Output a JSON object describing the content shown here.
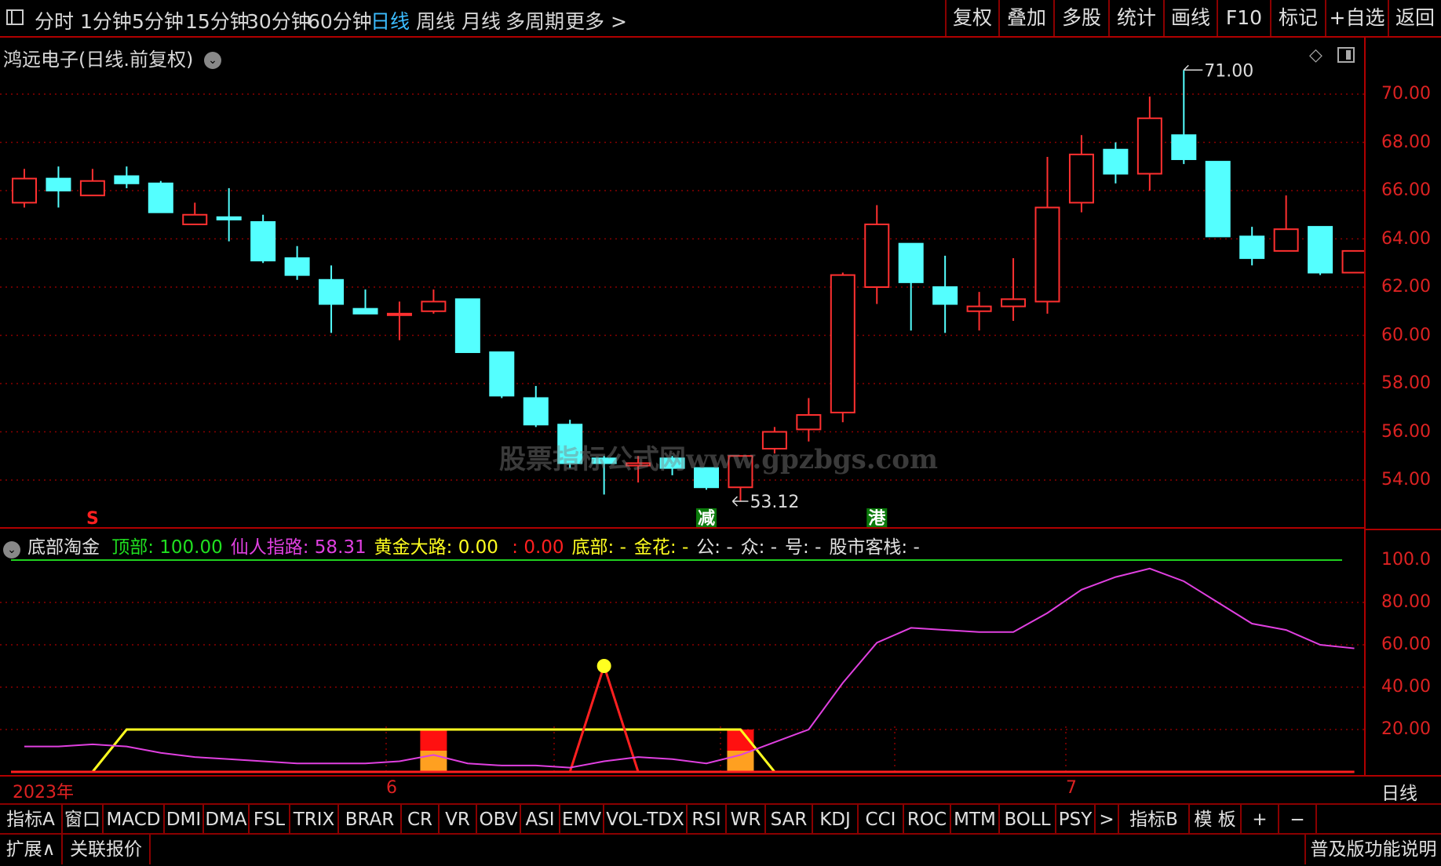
{
  "toolbar": {
    "left_items": [
      "分时",
      "1分钟",
      "5分钟",
      "15分钟",
      "30分钟",
      "60分钟",
      "日线",
      "周线",
      "月线",
      "多周期",
      "更多 >"
    ],
    "active": "日线",
    "right_items": [
      "复权",
      "叠加",
      "多股",
      "统计",
      "画线",
      "F10",
      "标记",
      "+自选",
      "返回"
    ]
  },
  "main": {
    "title": "鸿远电子(日线.前复权)",
    "high_label": "71.00",
    "low_label": "53.12",
    "signals": [
      {
        "text": "S",
        "color": "#ff2020"
      },
      {
        "text": "减",
        "color": "#30d030"
      },
      {
        "text": "港",
        "color": "#30d030"
      }
    ],
    "watermark": "股票指标公式网www.gpzbgs.com",
    "y_labels": [
      "70.00",
      "68.00",
      "66.00",
      "64.00",
      "62.00",
      "60.00",
      "58.00",
      "56.00",
      "54.00"
    ],
    "y_values": [
      70,
      68,
      66,
      64,
      62,
      60,
      58,
      56,
      54
    ]
  },
  "indicator": {
    "name": "底部淘金",
    "fields": [
      {
        "label": "顶部: ",
        "value": "100.00",
        "color": "#20e020"
      },
      {
        "label": "仙人指路: ",
        "value": "58.31",
        "color": "#e040e0"
      },
      {
        "label": "黄金大路: ",
        "value": "0.00",
        "color": "#ffff20"
      },
      {
        "label": " : ",
        "value": "0.00",
        "color": "#ff2020"
      },
      {
        "label": "底部: ",
        "value": "-",
        "color": "#ffff20"
      },
      {
        "label": "金花: ",
        "value": "-",
        "color": "#ffff20"
      },
      {
        "label": "公: ",
        "value": "-",
        "color": "#e0e0e0"
      },
      {
        "label": "众: ",
        "value": "-",
        "color": "#e0e0e0"
      },
      {
        "label": "号: ",
        "value": "-",
        "color": "#e0e0e0"
      },
      {
        "label": "股市客栈: ",
        "value": "-",
        "color": "#e0e0e0"
      }
    ],
    "y_labels": [
      "100.0",
      "80.00",
      "60.00",
      "40.00",
      "20.00"
    ],
    "y_values": [
      100,
      80,
      60,
      40,
      20
    ]
  },
  "date_axis": {
    "labels": [
      "2023年",
      "6",
      "7"
    ],
    "period": "日线"
  },
  "bottom_tabs": [
    "指标A",
    "窗口",
    "MACD",
    "DMI",
    "DMA",
    "FSL",
    "TRIX",
    "BRAR",
    "CR",
    "VR",
    "OBV",
    "ASI",
    "EMV",
    "VOL-TDX",
    "RSI",
    "WR",
    "SAR",
    "KDJ",
    "CCI",
    "ROC",
    "MTM",
    "BOLL",
    "PSY",
    ">",
    "指标B",
    "模 板",
    "+",
    "−"
  ],
  "status_bar": {
    "left": [
      "扩展∧",
      "关联报价"
    ],
    "right": "普及版功能说明"
  },
  "chart_data": {
    "type": "candlestick",
    "title": "鸿远电子(日线.前复权)",
    "candles": [
      {
        "o": 65.5,
        "h": 66.9,
        "l": 65.3,
        "c": 66.5
      },
      {
        "o": 66.5,
        "h": 67.0,
        "l": 65.3,
        "c": 66.0
      },
      {
        "o": 65.8,
        "h": 66.9,
        "l": 65.8,
        "c": 66.4
      },
      {
        "o": 66.6,
        "h": 67.0,
        "l": 66.1,
        "c": 66.3
      },
      {
        "o": 66.3,
        "h": 66.4,
        "l": 65.1,
        "c": 65.1
      },
      {
        "o": 64.6,
        "h": 65.5,
        "l": 64.6,
        "c": 65.0
      },
      {
        "o": 64.9,
        "h": 66.1,
        "l": 63.9,
        "c": 64.8
      },
      {
        "o": 64.7,
        "h": 65.0,
        "l": 63.0,
        "c": 63.1
      },
      {
        "o": 63.2,
        "h": 63.7,
        "l": 62.3,
        "c": 62.5
      },
      {
        "o": 62.3,
        "h": 62.9,
        "l": 60.1,
        "c": 61.3
      },
      {
        "o": 61.1,
        "h": 61.9,
        "l": 60.9,
        "c": 60.9
      },
      {
        "o": 60.9,
        "h": 61.4,
        "l": 59.8,
        "c": 60.9
      },
      {
        "o": 61.0,
        "h": 61.9,
        "l": 60.9,
        "c": 61.4
      },
      {
        "o": 61.5,
        "h": 61.5,
        "l": 59.3,
        "c": 59.3
      },
      {
        "o": 59.3,
        "h": 59.3,
        "l": 57.4,
        "c": 57.5
      },
      {
        "o": 57.4,
        "h": 57.9,
        "l": 56.2,
        "c": 56.3
      },
      {
        "o": 56.3,
        "h": 56.5,
        "l": 54.5,
        "c": 54.7
      },
      {
        "o": 54.9,
        "h": 55.0,
        "l": 53.4,
        "c": 54.7
      },
      {
        "o": 54.6,
        "h": 55.0,
        "l": 53.9,
        "c": 54.7
      },
      {
        "o": 54.9,
        "h": 55.0,
        "l": 54.2,
        "c": 54.5
      },
      {
        "o": 54.5,
        "h": 54.5,
        "l": 53.6,
        "c": 53.7
      },
      {
        "o": 53.7,
        "h": 55.0,
        "l": 53.1,
        "c": 55.0
      },
      {
        "o": 55.3,
        "h": 56.2,
        "l": 55.1,
        "c": 56.0
      },
      {
        "o": 56.1,
        "h": 57.4,
        "l": 55.6,
        "c": 56.7
      },
      {
        "o": 56.8,
        "h": 62.6,
        "l": 56.4,
        "c": 62.5
      },
      {
        "o": 62.0,
        "h": 65.4,
        "l": 61.3,
        "c": 64.6
      },
      {
        "o": 63.8,
        "h": 63.8,
        "l": 60.2,
        "c": 62.2
      },
      {
        "o": 62.0,
        "h": 63.3,
        "l": 60.1,
        "c": 61.3
      },
      {
        "o": 61.0,
        "h": 61.8,
        "l": 60.2,
        "c": 61.2
      },
      {
        "o": 61.2,
        "h": 63.2,
        "l": 60.6,
        "c": 61.5
      },
      {
        "o": 61.4,
        "h": 67.4,
        "l": 60.9,
        "c": 65.3
      },
      {
        "o": 65.5,
        "h": 68.3,
        "l": 65.1,
        "c": 67.5
      },
      {
        "o": 67.7,
        "h": 68.0,
        "l": 66.3,
        "c": 66.7
      },
      {
        "o": 66.7,
        "h": 69.9,
        "l": 66.0,
        "c": 69.0
      },
      {
        "o": 68.3,
        "h": 71.0,
        "l": 67.1,
        "c": 67.3
      },
      {
        "o": 67.2,
        "h": 67.2,
        "l": 64.1,
        "c": 64.1
      },
      {
        "o": 64.1,
        "h": 64.5,
        "l": 62.9,
        "c": 63.2
      },
      {
        "o": 63.5,
        "h": 65.8,
        "l": 63.5,
        "c": 64.4
      },
      {
        "o": 64.5,
        "h": 64.5,
        "l": 62.5,
        "c": 62.6
      },
      {
        "o": 62.6,
        "h": 63.5,
        "l": 62.6,
        "c": 63.5
      }
    ],
    "series": [
      {
        "name": "顶部",
        "values": [
          100,
          100,
          100,
          100,
          100,
          100,
          100,
          100,
          100,
          100,
          100,
          100,
          100,
          100,
          100,
          100,
          100,
          100,
          100,
          100,
          100,
          100,
          100,
          100,
          100,
          100,
          100,
          100,
          100,
          100,
          100,
          100,
          100,
          100,
          100,
          100,
          100,
          100,
          100,
          100
        ]
      },
      {
        "name": "仙人指路",
        "values": [
          12,
          12,
          13,
          12,
          9,
          7,
          6,
          5,
          4,
          4,
          4,
          5,
          8,
          4,
          3,
          3,
          2,
          5,
          7,
          6,
          4,
          8,
          14,
          20,
          42,
          61,
          68,
          67,
          66,
          66,
          75,
          86,
          92,
          96,
          90,
          80,
          70,
          67,
          60,
          58.31
        ]
      },
      {
        "name": "黄金大路",
        "values": [
          0,
          0,
          0,
          20,
          20,
          20,
          20,
          20,
          20,
          20,
          20,
          20,
          20,
          20,
          20,
          20,
          20,
          20,
          20,
          20,
          20,
          20,
          0,
          0,
          0,
          0,
          0,
          0,
          0,
          0,
          0,
          0,
          0,
          0,
          0,
          0,
          0,
          0,
          0,
          0
        ]
      },
      {
        "name": "底部",
        "values": [
          0,
          0,
          0,
          0,
          0,
          0,
          0,
          0,
          0,
          0,
          0,
          0,
          0,
          0,
          0,
          0,
          0,
          50,
          0,
          0,
          0,
          0,
          0,
          0,
          0,
          0,
          0,
          0,
          0,
          0,
          0,
          0,
          0,
          0,
          0,
          0,
          0,
          0,
          0,
          0
        ]
      }
    ],
    "price_ylim": [
      53,
      71
    ],
    "indicator_ylim": [
      0,
      100
    ],
    "x_labels": [
      "2023年",
      "6",
      "7"
    ]
  }
}
